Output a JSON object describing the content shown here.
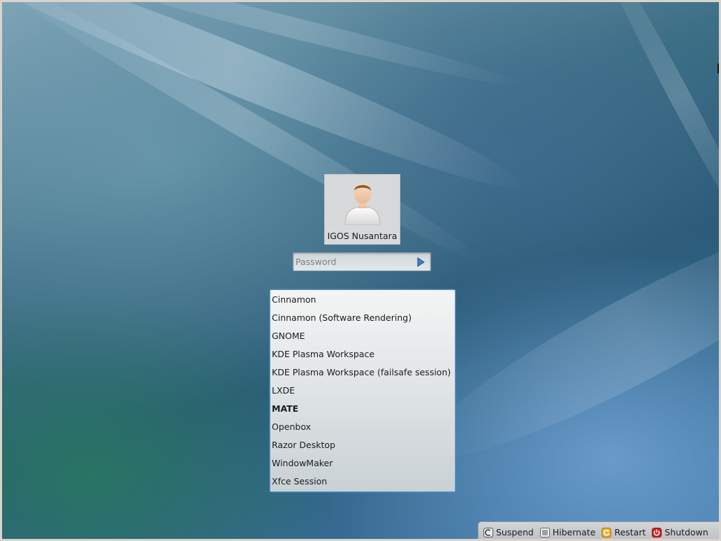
{
  "user": {
    "name": "IGOS Nusantara",
    "avatar_icon": "user-avatar-icon"
  },
  "login": {
    "password_placeholder": "Password",
    "password_value": "",
    "submit_icon": "arrow-right-icon"
  },
  "sessions": {
    "items": [
      {
        "label": "Cinnamon"
      },
      {
        "label": "Cinnamon (Software Rendering)"
      },
      {
        "label": "GNOME"
      },
      {
        "label": "KDE Plasma Workspace"
      },
      {
        "label": "KDE Plasma Workspace (failsafe session)"
      },
      {
        "label": "LXDE"
      },
      {
        "label": "MATE"
      },
      {
        "label": "Openbox"
      },
      {
        "label": "Razor Desktop"
      },
      {
        "label": "WindowMaker"
      },
      {
        "label": "Xfce Session"
      }
    ],
    "selected": "MATE"
  },
  "power": {
    "suspend_label": "Suspend",
    "hibernate_label": "Hibernate",
    "restart_label": "Restart",
    "shutdown_label": "Shutdown"
  },
  "colors": {
    "accent": "#5d9bd6",
    "restart": "#e8a319",
    "shutdown": "#d42020"
  }
}
